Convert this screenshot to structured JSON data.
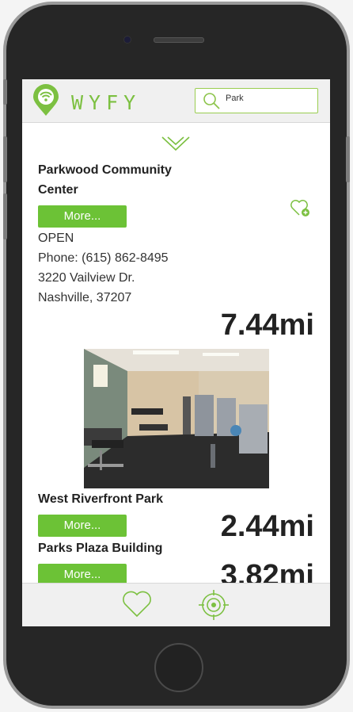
{
  "app": {
    "logo_text": "WYFY"
  },
  "search": {
    "value": "Park"
  },
  "results": [
    {
      "name": "Parkwood Community Center",
      "name_line1": "Parkwood Community",
      "name_line2": "Center",
      "more_label": "More...",
      "status": "OPEN",
      "phone": "Phone: (615) 862-8495",
      "address_line1": "3220 Vailview Dr.",
      "address_line2": "Nashville, 37207",
      "distance": "7.44mi",
      "favorite": false
    },
    {
      "name": "West Riverfront Park",
      "more_label": "More...",
      "distance": "2.44mi"
    },
    {
      "name": "Parks Plaza Building",
      "more_label": "More...",
      "distance": "3.82mi"
    }
  ],
  "icons": {
    "logo": "location-pin-wifi-icon",
    "search": "search-icon",
    "collapse": "chevron-down-icon",
    "favorite": "heart-add-icon",
    "favorites_tab": "heart-icon",
    "location_tab": "crosshair-target-icon"
  },
  "colors": {
    "accent": "#7cc041",
    "button": "#6cc236"
  }
}
